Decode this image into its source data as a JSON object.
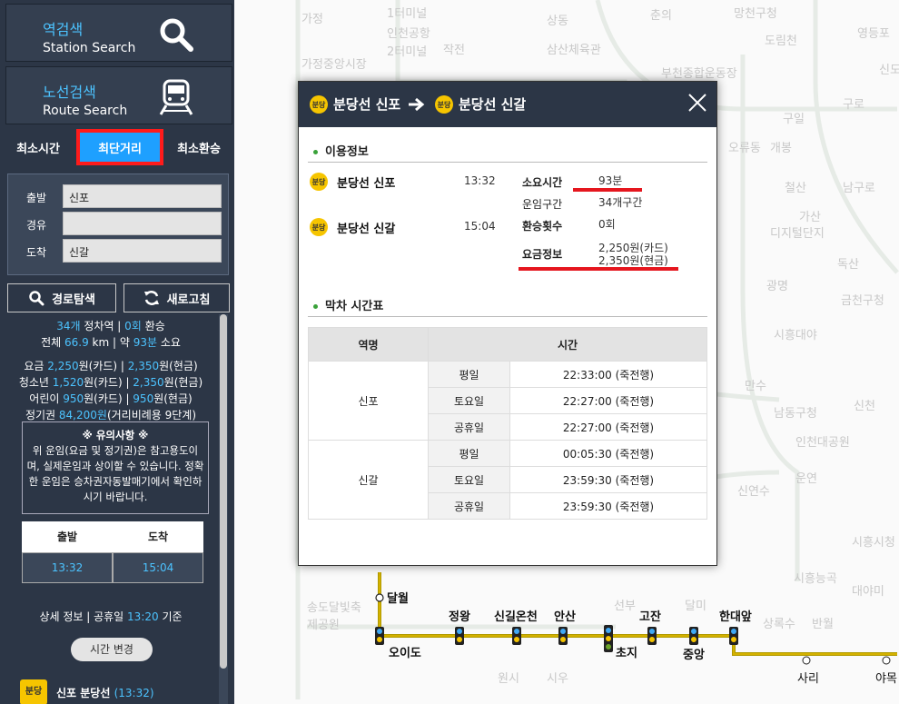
{
  "sidebar": {
    "station_search": {
      "ko": "역검색",
      "en": "Station Search",
      "icon": "search-icon"
    },
    "route_search": {
      "ko": "노선검색",
      "en": "Route Search",
      "icon": "train-icon"
    },
    "tabs": [
      {
        "label": "최소시간",
        "active": false
      },
      {
        "label": "최단거리",
        "active": true
      },
      {
        "label": "최소환승",
        "active": false
      }
    ],
    "form": {
      "departure_label": "출발",
      "departure_value": "신포",
      "via_label": "경유",
      "via_value": "",
      "arrival_label": "도착",
      "arrival_value": "신갈"
    },
    "search_button": "경로탐색",
    "refresh_button": "새로고침",
    "summary": {
      "stops_count": "34개",
      "stops_suffix": " 정차역 | ",
      "transfer_count": "0회",
      "transfer_suffix": " 환승",
      "total_prefix": "전체 ",
      "distance": "66.9",
      "distance_unit": " km | 약 ",
      "minutes": "93분",
      "minutes_suffix": " 소요",
      "fare_rows": [
        {
          "label": "요금 ",
          "card": "2,250",
          "cash": "2,350"
        },
        {
          "label": "청소년 ",
          "card": "1,520",
          "cash": "2,350"
        },
        {
          "label": "어린이 ",
          "card": "950",
          "cash": "950"
        }
      ],
      "fare_card_suffix": "원(카드) | ",
      "fare_cash_suffix": "원(현금)",
      "pass_label": "정기권 ",
      "pass_value": "84,200원",
      "pass_suffix": "(거리비례용 9단계)"
    },
    "notice": {
      "title": "※ 유의사항 ※",
      "body": "위 운임(요금 및 정기권)은 참고용도이며, 실제운임과 상이할 수 있습니다. 정확한 운임은 승차권자동발매기에서 확인하시기 바랍니다."
    },
    "times": {
      "dep_label": "출발",
      "arr_label": "도착",
      "dep": "13:32",
      "arr": "15:04"
    },
    "detail": {
      "prefix": "상세 정보 | 공휴일 ",
      "time": "13:20",
      "suffix": " 기준"
    },
    "change_time_button": "시간 변경",
    "first_step": {
      "badge": "분당",
      "name": "신포 분당선",
      "time": "(13:32)"
    }
  },
  "map": {
    "faint_labels": [
      "가정",
      "1터미널",
      "인천공항",
      "2터미널",
      "가정중앙시장",
      "작전",
      "상동",
      "삼산체육관",
      "부천종합운동장",
      "춘의",
      "망천구청",
      "도림천",
      "영등포",
      "신도",
      "구일",
      "구로",
      "오류동",
      "개봉",
      "철산",
      "남구로",
      "가산",
      "디지털단지",
      "독산",
      "광명",
      "금천구청",
      "시흥대야",
      "신천",
      "만수",
      "남동구청",
      "인천대공원",
      "운연",
      "신연수",
      "시흥능곡",
      "시흥시청",
      "대야미",
      "상록수",
      "반월",
      "송도달빛축제공원",
      "원시",
      "시우",
      "선부",
      "달미",
      "초지"
    ],
    "station_labels": [
      "달월",
      "오이도",
      "정왕",
      "신길온천",
      "안산",
      "초지",
      "고잔",
      "중앙",
      "한대앞",
      "사리",
      "야목"
    ]
  },
  "modal": {
    "line_badge": "분당",
    "from": "분당선 신포",
    "to": "분당선 신갈",
    "section_usage": "이용정보",
    "stations": [
      {
        "name": "분당선 신포",
        "time": "13:32"
      },
      {
        "name": "분당선 신갈",
        "time": "15:04"
      }
    ],
    "info": {
      "duration_label": "소요시간",
      "duration_value": "93분",
      "fare_section_label": "운임구간",
      "fare_section_value": "34개구간",
      "transfers_label": "환승횟수",
      "transfers_value": "0회",
      "fare_label": "요금정보",
      "fare_card": "2,250원(카드)",
      "fare_cash": "2,350원(현금)"
    },
    "section_last_train": "막차 시간표",
    "table": {
      "col_station": "역명",
      "col_time": "시간",
      "rows": [
        {
          "station": "신포",
          "entries": [
            {
              "day": "평일",
              "time": "22:33:00 (죽전행)"
            },
            {
              "day": "토요일",
              "time": "22:27:00 (죽전행)"
            },
            {
              "day": "공휴일",
              "time": "22:27:00 (죽전행)"
            }
          ]
        },
        {
          "station": "신갈",
          "entries": [
            {
              "day": "평일",
              "time": "00:05:30 (죽전행)"
            },
            {
              "day": "토요일",
              "time": "23:59:30 (죽전행)"
            },
            {
              "day": "공휴일",
              "time": "23:59:30 (죽전행)"
            }
          ]
        }
      ]
    }
  }
}
